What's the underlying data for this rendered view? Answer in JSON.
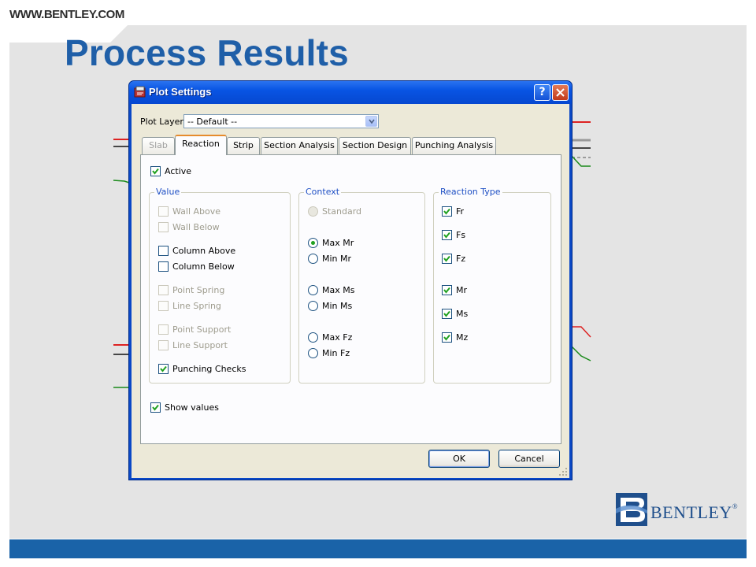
{
  "slide": {
    "url": "WWW.BENTLEY.COM",
    "title": "Process Results",
    "logo_text": "BENTLEY",
    "logo_mark": "®"
  },
  "dialog": {
    "title": "Plot Settings",
    "help_label": "?",
    "close_label": "✕",
    "plot_layer_label": "Plot Layer:",
    "plot_layer_value": "-- Default --",
    "tabs": [
      {
        "label": "Slab",
        "state": "disabled"
      },
      {
        "label": "Reaction",
        "state": "active"
      },
      {
        "label": "Strip",
        "state": "normal"
      },
      {
        "label": "Section Analysis",
        "state": "normal"
      },
      {
        "label": "Section Design",
        "state": "normal"
      },
      {
        "label": "Punching Analysis",
        "state": "normal"
      }
    ],
    "active": {
      "label": "Active",
      "checked": true
    },
    "value_group": {
      "title": "Value",
      "items": [
        {
          "label": "Wall Above",
          "checked": false,
          "enabled": false
        },
        {
          "label": "Wall Below",
          "checked": false,
          "enabled": false
        },
        {
          "label": "Column Above",
          "checked": false,
          "enabled": true
        },
        {
          "label": "Column Below",
          "checked": false,
          "enabled": true
        },
        {
          "label": "Point Spring",
          "checked": false,
          "enabled": false
        },
        {
          "label": "Line Spring",
          "checked": false,
          "enabled": false
        },
        {
          "label": "Point Support",
          "checked": false,
          "enabled": false
        },
        {
          "label": "Line Support",
          "checked": false,
          "enabled": false
        },
        {
          "label": "Punching Checks",
          "checked": true,
          "enabled": true
        }
      ]
    },
    "context_group": {
      "title": "Context",
      "items": [
        {
          "label": "Standard",
          "selected": false,
          "enabled": false
        },
        {
          "label": "Max Mr",
          "selected": true,
          "enabled": true
        },
        {
          "label": "Min Mr",
          "selected": false,
          "enabled": true
        },
        {
          "label": "Max Ms",
          "selected": false,
          "enabled": true
        },
        {
          "label": "Min Ms",
          "selected": false,
          "enabled": true
        },
        {
          "label": "Max Fz",
          "selected": false,
          "enabled": true
        },
        {
          "label": "Min Fz",
          "selected": false,
          "enabled": true
        }
      ]
    },
    "reaction_group": {
      "title": "Reaction Type",
      "items": [
        {
          "label": "Fr",
          "checked": true
        },
        {
          "label": "Fs",
          "checked": true
        },
        {
          "label": "Fz",
          "checked": true
        },
        {
          "label": "Mr",
          "checked": true
        },
        {
          "label": "Ms",
          "checked": true
        },
        {
          "label": "Mz",
          "checked": true
        }
      ]
    },
    "show_values": {
      "label": "Show values",
      "checked": true
    },
    "ok_label": "OK",
    "cancel_label": "Cancel"
  },
  "colors": {
    "title_blue": "#1f5fa8",
    "bar_blue": "#1a63a8",
    "xp_blue": "#0854e3",
    "check_green": "#21a121"
  }
}
